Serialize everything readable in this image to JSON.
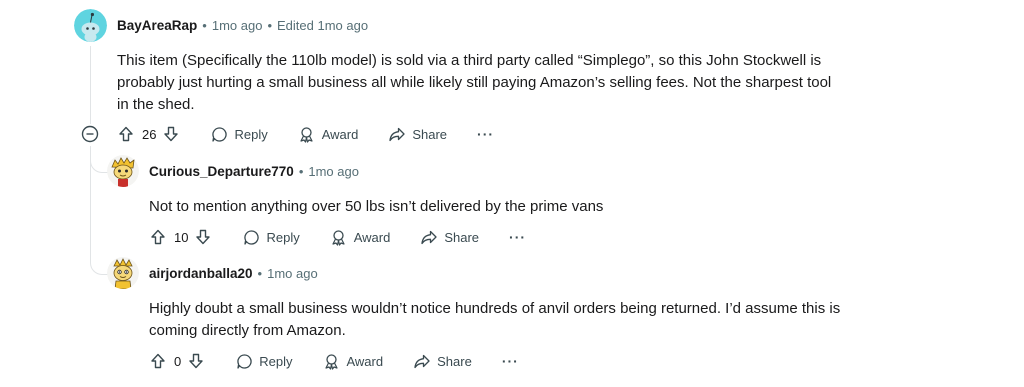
{
  "comments": [
    {
      "username": "BayAreaRap",
      "time": "1mo ago",
      "edited": "Edited 1mo ago",
      "body": "This item (Specifically the 110lb model) is sold via a third party called “Simplego”, so this John Stockwell is probably just hurting a small business all while likely still paying Amazon’s selling fees. Not the sharpest tool in the shed.",
      "votes": "26",
      "reply_label": "Reply",
      "award_label": "Award",
      "share_label": "Share",
      "more_label": "···",
      "avatar_icon": "snoo-avatar-icon"
    },
    {
      "username": "Curious_Departure770",
      "time": "1mo ago",
      "body": "Not to mention anything over 50 lbs isn’t delivered by the prime vans",
      "votes": "10",
      "reply_label": "Reply",
      "award_label": "Award",
      "share_label": "Share",
      "more_label": "···",
      "avatar_icon": "cartoon-avatar-icon"
    },
    {
      "username": "airjordanballa20",
      "time": "1mo ago",
      "body": "Highly doubt a small business wouldn’t notice hundreds of anvil orders being returned. I’d assume this is coming directly from Amazon.",
      "votes": "0",
      "reply_label": "Reply",
      "award_label": "Award",
      "share_label": "Share",
      "more_label": "···",
      "avatar_icon": "cartoon-avatar-icon"
    }
  ],
  "separator": "•",
  "colors": {
    "meta": "#576f76",
    "thread_line": "#e1e4e6",
    "snoo_bg": "#5fd4e0"
  }
}
